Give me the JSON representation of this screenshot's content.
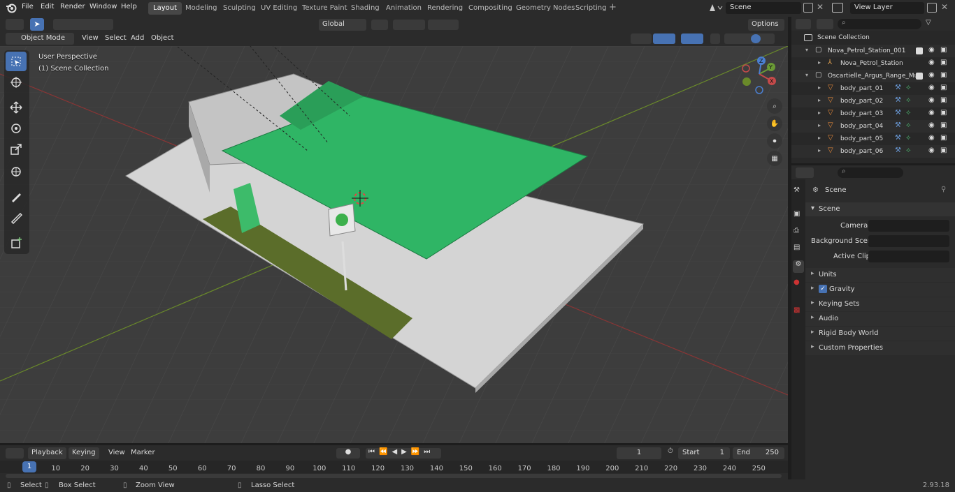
{
  "top_menu": {
    "file": "File",
    "edit": "Edit",
    "render": "Render",
    "window": "Window",
    "help": "Help"
  },
  "workspace_tabs": [
    {
      "label": "Layout",
      "active": true
    },
    {
      "label": "Modeling"
    },
    {
      "label": "Sculpting"
    },
    {
      "label": "UV Editing"
    },
    {
      "label": "Texture Paint"
    },
    {
      "label": "Shading"
    },
    {
      "label": "Animation"
    },
    {
      "label": "Rendering"
    },
    {
      "label": "Compositing"
    },
    {
      "label": "Geometry Nodes"
    },
    {
      "label": "Scripting"
    }
  ],
  "add_workspace": "+",
  "scene_field": "Scene",
  "view_layer_field": "View Layer",
  "viewport_header": {
    "mode": "Object Mode",
    "view": "View",
    "select": "Select",
    "add": "Add",
    "object": "Object",
    "transform_orientation": "Global",
    "options": "Options"
  },
  "viewport_overlay": {
    "perspective": "User Perspective",
    "collection": "(1) Scene Collection"
  },
  "gizmo_axes": {
    "x": "X",
    "y": "Y",
    "z": "Z"
  },
  "outliner": {
    "root": "Scene Collection",
    "rows": [
      {
        "label": "Nova_Petrol_Station_001",
        "indent": 0,
        "type": "collection"
      },
      {
        "label": "Nova_Petrol_Station",
        "indent": 1,
        "type": "empty"
      },
      {
        "label": "Oscartielle_Argus_Range_Mul",
        "indent": 0,
        "type": "collection"
      },
      {
        "label": "body_part_01",
        "indent": 1,
        "type": "mesh"
      },
      {
        "label": "body_part_02",
        "indent": 1,
        "type": "mesh"
      },
      {
        "label": "body_part_03",
        "indent": 1,
        "type": "mesh"
      },
      {
        "label": "body_part_04",
        "indent": 1,
        "type": "mesh"
      },
      {
        "label": "body_part_05",
        "indent": 1,
        "type": "mesh"
      },
      {
        "label": "body_part_06",
        "indent": 1,
        "type": "mesh"
      }
    ]
  },
  "properties": {
    "context_title": "Scene",
    "panel_title": "Scene",
    "camera_label": "Camera",
    "background_scene_label": "Background Scene",
    "active_clip_label": "Active Clip",
    "collapsed_panels": [
      "Units",
      "Gravity",
      "Keying Sets",
      "Audio",
      "Rigid Body World",
      "Custom Properties"
    ],
    "gravity_checked": true
  },
  "timeline": {
    "playback": "Playback",
    "keying": "Keying",
    "view": "View",
    "marker": "Marker",
    "current_frame": "1",
    "start_label": "Start",
    "start_value": "1",
    "end_label": "End",
    "end_value": "250",
    "ruler_current": "1",
    "ticks": [
      "10",
      "20",
      "30",
      "40",
      "50",
      "60",
      "70",
      "80",
      "90",
      "100",
      "110",
      "120",
      "130",
      "140",
      "150",
      "160",
      "170",
      "180",
      "190",
      "200",
      "210",
      "220",
      "230",
      "240",
      "250"
    ]
  },
  "statusbar": {
    "select": "Select",
    "box_select": "Box Select",
    "zoom_view": "Zoom View",
    "lasso_select": "Lasso Select",
    "version": "2.93.18"
  },
  "colors": {
    "accent": "#4772b3",
    "canopy_green": "#2fb565",
    "viewport_bg": "#3d3d3d",
    "x_axis": "#b8413f",
    "y_axis": "#7ea028"
  }
}
